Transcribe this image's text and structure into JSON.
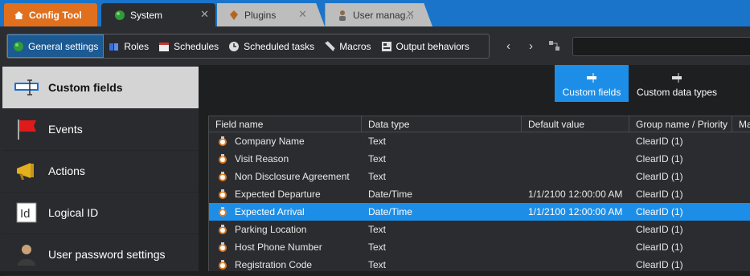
{
  "tabs": {
    "config": "Config Tool",
    "system": "System",
    "plugins": "Plugins",
    "users": "User manag..."
  },
  "toolbar": {
    "items": [
      "General settings",
      "Roles",
      "Schedules",
      "Scheduled tasks",
      "Macros",
      "Output behaviors"
    ],
    "active_index": 0
  },
  "sidebar": {
    "items": [
      "Custom fields",
      "Events",
      "Actions",
      "Logical ID",
      "User password settings"
    ],
    "active_index": 0
  },
  "subtabs": {
    "custom_fields": "Custom fields",
    "custom_data_types": "Custom data types"
  },
  "grid": {
    "columns": [
      "Field name",
      "Data type",
      "Default value",
      "Group name / Priority",
      "Ma"
    ],
    "rows": [
      {
        "name": "Company Name",
        "type": "Text",
        "default": "",
        "group": "ClearID (1)"
      },
      {
        "name": "Visit Reason",
        "type": "Text",
        "default": "",
        "group": "ClearID (1)"
      },
      {
        "name": "Non Disclosure Agreement",
        "type": "Text",
        "default": "",
        "group": "ClearID (1)"
      },
      {
        "name": "Expected Departure",
        "type": "Date/Time",
        "default": "1/1/2100 12:00:00 AM",
        "group": "ClearID (1)"
      },
      {
        "name": "Expected Arrival",
        "type": "Date/Time",
        "default": "1/1/2100 12:00:00 AM",
        "group": "ClearID (1)"
      },
      {
        "name": "Parking Location",
        "type": "Text",
        "default": "",
        "group": "ClearID (1)"
      },
      {
        "name": "Host Phone Number",
        "type": "Text",
        "default": "",
        "group": "ClearID (1)"
      },
      {
        "name": "Registration Code",
        "type": "Text",
        "default": "",
        "group": "ClearID (1)"
      }
    ],
    "selected_index": 4
  },
  "colors": {
    "accent": "#1d8ee8",
    "tab_bar": "#1a74c9",
    "config_tab": "#e0701e"
  }
}
